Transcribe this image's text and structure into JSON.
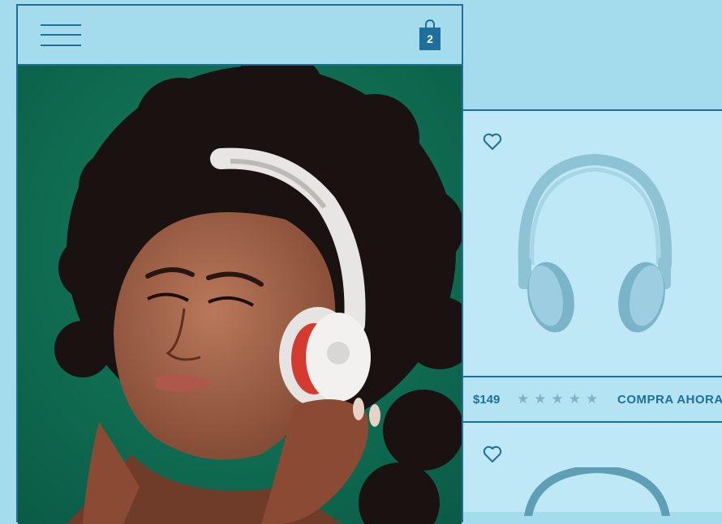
{
  "header": {
    "cart_count": "2"
  },
  "products": [
    {
      "price": "$149",
      "rating": 0,
      "rating_max": 5,
      "buy_label": "COMPRA AHORA"
    }
  ],
  "colors": {
    "background": "#a4dcee",
    "accent": "#1f6f9c",
    "hero_background": "#0f6e55",
    "star_inactive": "#7fb3c8"
  },
  "icons": [
    "menu-icon",
    "shopping-bag-icon",
    "heart-icon",
    "star-icon"
  ]
}
